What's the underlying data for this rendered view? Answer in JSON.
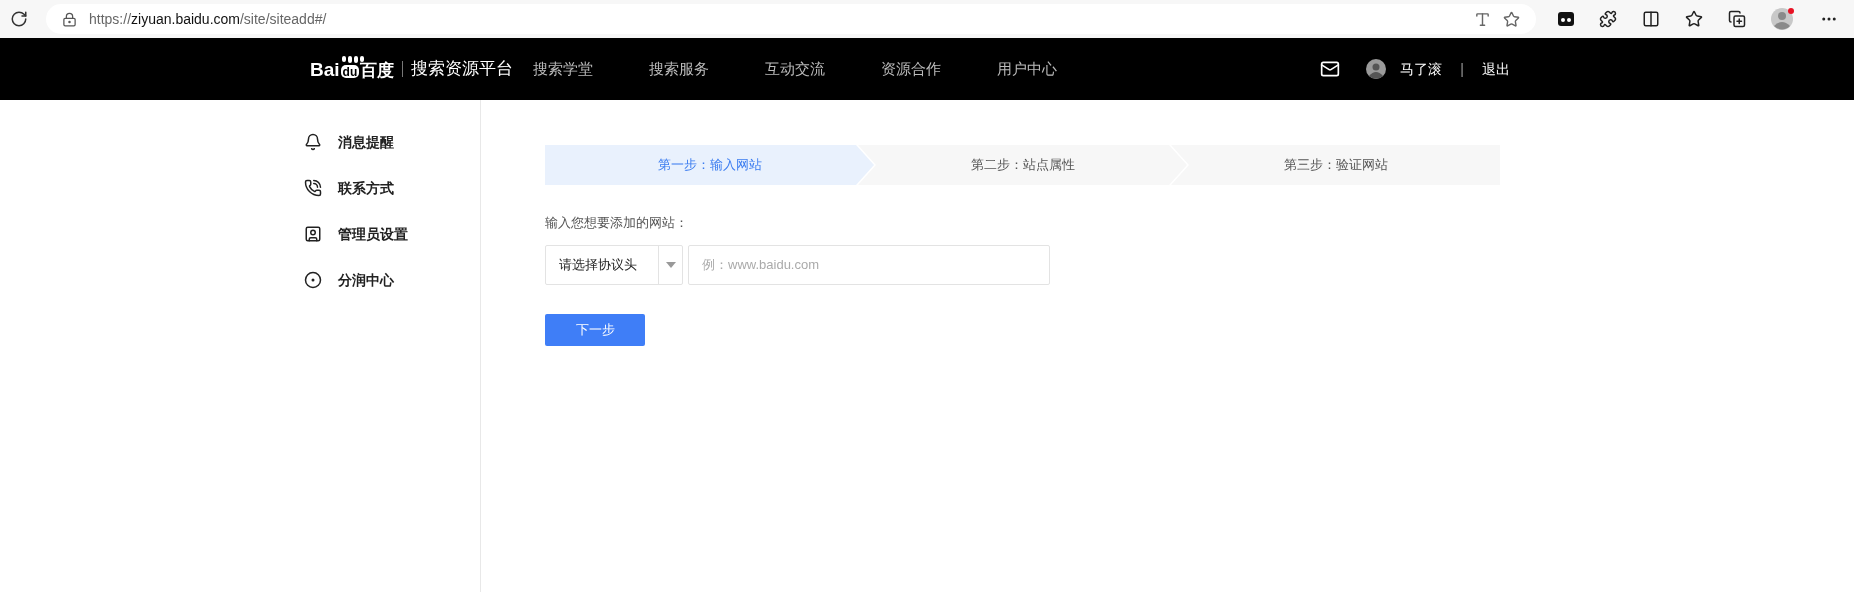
{
  "browser": {
    "url_scheme": "https://",
    "url_host": "ziyuan.baidu.com",
    "url_path": "/site/siteadd#/"
  },
  "header": {
    "logo": {
      "left": "Bai",
      "paw": "du",
      "right": "百度"
    },
    "platform": "搜索资源平台",
    "nav": [
      {
        "label": "搜索学堂"
      },
      {
        "label": "搜索服务"
      },
      {
        "label": "互动交流"
      },
      {
        "label": "资源合作"
      },
      {
        "label": "用户中心"
      }
    ],
    "user": {
      "name": "马了滚",
      "separator": "|",
      "logout": "退出"
    }
  },
  "sidebar": {
    "items": [
      {
        "label": "消息提醒"
      },
      {
        "label": "联系方式"
      },
      {
        "label": "管理员设置"
      },
      {
        "label": "分润中心"
      }
    ]
  },
  "steps": [
    {
      "label": "第一步：输入网站",
      "selected": true
    },
    {
      "label": "第二步：站点属性",
      "selected": false
    },
    {
      "label": "第三步：验证网站",
      "selected": false
    }
  ],
  "form": {
    "label": "输入您想要添加的网站：",
    "protocol_select": {
      "value": "请选择协议头"
    },
    "site_input": {
      "placeholder": "例：www.baidu.com"
    },
    "next_button": "下一步"
  }
}
